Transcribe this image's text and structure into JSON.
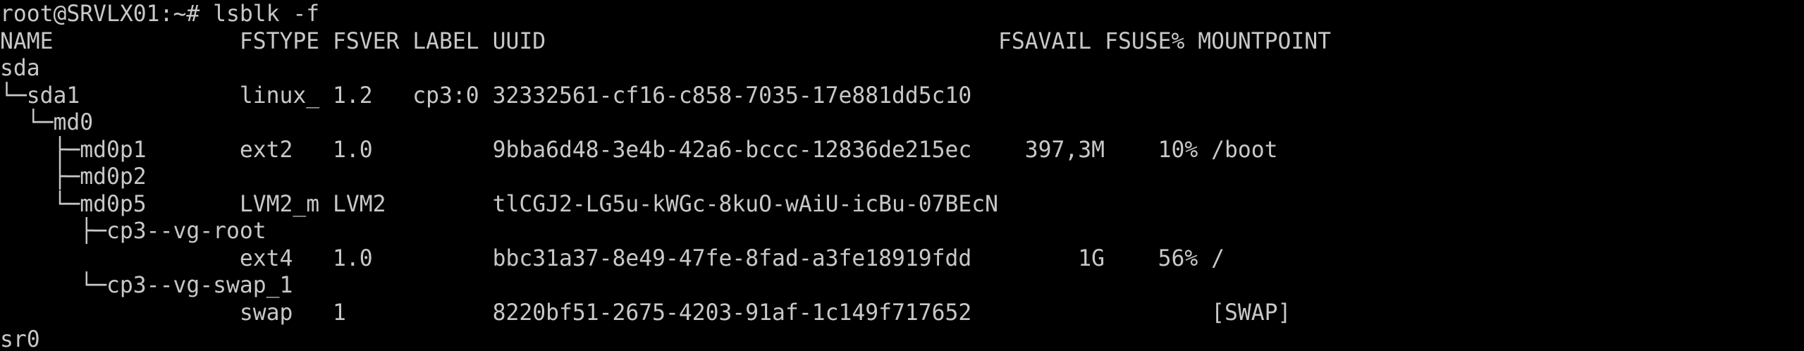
{
  "terminal": {
    "title": "",
    "lines": [
      "root@SRVLX01:~# lsblk -f",
      "NAME              FSTYPE FSVER LABEL UUID                                  FSAVAIL FSUSE% MOUNTPOINT",
      "sda",
      "└─sda1            linux_ 1.2   cp3:0 32332561-cf16-c858-7035-17e881dd5c10",
      "  └─md0",
      "    ├─md0p1       ext2   1.0         9bba6d48-3e4b-42a6-bccc-12836de215ec    397,3M    10% /boot",
      "    ├─md0p2",
      "    └─md0p5       LVM2_m LVM2        tlCGJ2-LG5u-kWGc-8kuO-wAiU-icBu-07BEcN",
      "      ├─cp3--vg-root",
      "                  ext4   1.0         bbc31a37-8e49-47fe-8fad-a3fe18919fdd        1G    56% /",
      "      └─cp3--vg-swap_1",
      "                  swap   1           8220bf51-2675-4203-91af-1c149f717652                  [SWAP]",
      "sr0"
    ]
  },
  "colors": {
    "background": "#000000",
    "foreground": "#c8c8c8"
  }
}
